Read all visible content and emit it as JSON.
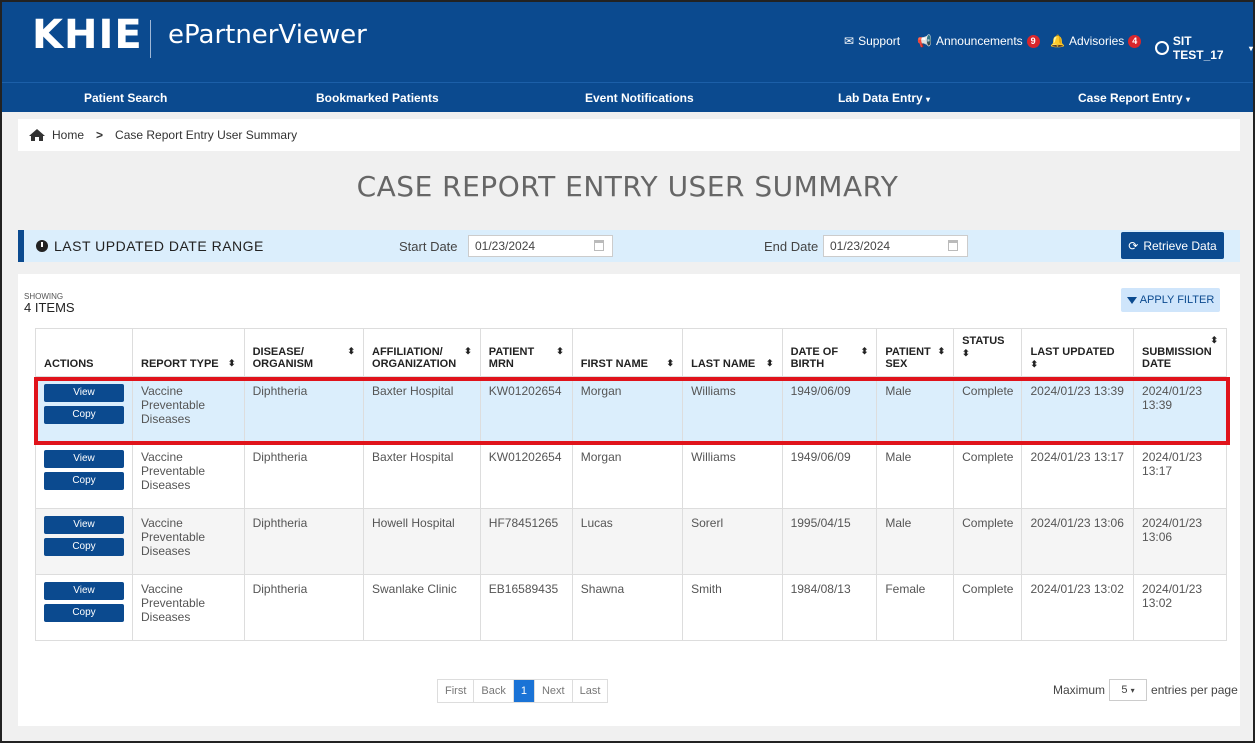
{
  "header": {
    "logo": "KHIE",
    "app_name": "ePartnerViewer",
    "support": "Support",
    "announcements": "Announcements",
    "announcements_count": "9",
    "advisories": "Advisories",
    "advisories_count": "4",
    "user": "SIT TEST_17"
  },
  "nav": {
    "items": [
      "Patient Search",
      "Bookmarked Patients",
      "Event Notifications",
      "Lab Data Entry",
      "Case Report Entry"
    ]
  },
  "breadcrumb": {
    "home": "Home",
    "current": "Case Report Entry User Summary"
  },
  "page_title": "CASE REPORT ENTRY USER SUMMARY",
  "date_range": {
    "title": "LAST UPDATED DATE RANGE",
    "start_label": "Start Date",
    "start_value": "01/23/2024",
    "end_label": "End Date",
    "end_value": "01/23/2024",
    "retrieve": "Retrieve Data"
  },
  "list": {
    "showing_label": "SHOWING",
    "showing_count": "4 ITEMS",
    "apply_filter": "APPLY FILTER",
    "columns": [
      "ACTIONS",
      "REPORT TYPE",
      "DISEASE/ ORGANISM",
      "AFFILIATION/ ORGANIZATION",
      "PATIENT MRN",
      "FIRST NAME",
      "LAST NAME",
      "DATE OF BIRTH",
      "PATIENT SEX",
      "STATUS",
      "LAST UPDATED",
      "SUBMISSION DATE"
    ],
    "view_label": "View",
    "copy_label": "Copy",
    "rows": [
      {
        "report_type": "Vaccine Preventable Diseases",
        "disease": "Diphtheria",
        "org": "Baxter Hospital",
        "mrn": "KW01202654",
        "first": "Morgan",
        "last": "Williams",
        "dob": "1949/06/09",
        "sex": "Male",
        "status": "Complete",
        "updated": "2024/01/23 13:39",
        "submitted": "2024/01/23 13:39"
      },
      {
        "report_type": "Vaccine Preventable Diseases",
        "disease": "Diphtheria",
        "org": "Baxter Hospital",
        "mrn": "KW01202654",
        "first": "Morgan",
        "last": "Williams",
        "dob": "1949/06/09",
        "sex": "Male",
        "status": "Complete",
        "updated": "2024/01/23 13:17",
        "submitted": "2024/01/23 13:17"
      },
      {
        "report_type": "Vaccine Preventable Diseases",
        "disease": "Diphtheria",
        "org": "Howell Hospital",
        "mrn": "HF78451265",
        "first": "Lucas",
        "last": "Sorerl",
        "dob": "1995/04/15",
        "sex": "Male",
        "status": "Complete",
        "updated": "2024/01/23 13:06",
        "submitted": "2024/01/23 13:06"
      },
      {
        "report_type": "Vaccine Preventable Diseases",
        "disease": "Diphtheria",
        "org": "Swanlake Clinic",
        "mrn": "EB16589435",
        "first": "Shawna",
        "last": "Smith",
        "dob": "1984/08/13",
        "sex": "Female",
        "status": "Complete",
        "updated": "2024/01/23 13:02",
        "submitted": "2024/01/23 13:02"
      }
    ]
  },
  "pager": {
    "first": "First",
    "back": "Back",
    "page": "1",
    "next": "Next",
    "last": "Last"
  },
  "entries": {
    "maximum": "Maximum",
    "value": "5",
    "suffix": "entries per page"
  }
}
